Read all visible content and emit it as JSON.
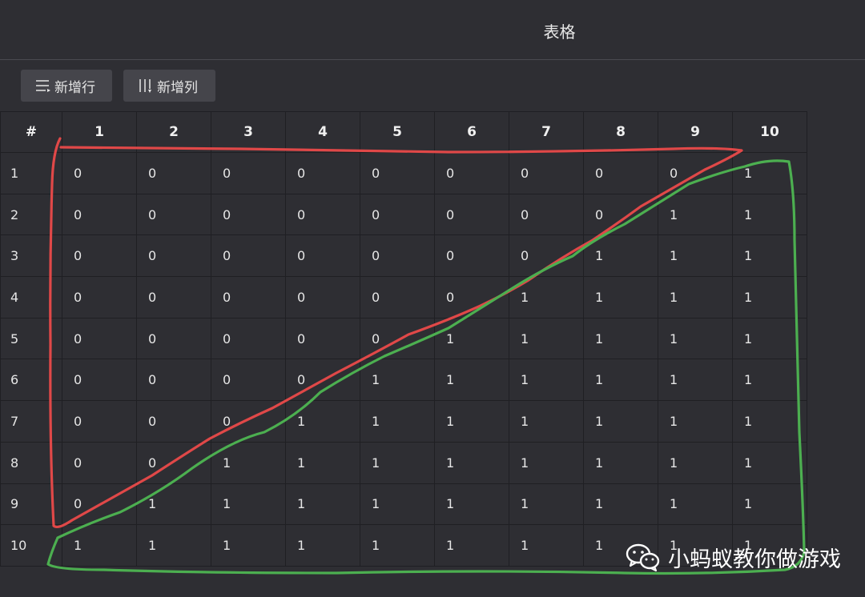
{
  "window": {
    "title": "表格"
  },
  "toolbar": {
    "add_row_label": "新增行",
    "add_col_label": "新增列"
  },
  "table": {
    "corner": "#",
    "columns": [
      "1",
      "2",
      "3",
      "4",
      "5",
      "6",
      "7",
      "8",
      "9",
      "10"
    ],
    "rows": [
      {
        "label": "1",
        "cells": [
          "0",
          "0",
          "0",
          "0",
          "0",
          "0",
          "0",
          "0",
          "0",
          "1"
        ]
      },
      {
        "label": "2",
        "cells": [
          "0",
          "0",
          "0",
          "0",
          "0",
          "0",
          "0",
          "0",
          "1",
          "1"
        ]
      },
      {
        "label": "3",
        "cells": [
          "0",
          "0",
          "0",
          "0",
          "0",
          "0",
          "0",
          "1",
          "1",
          "1"
        ]
      },
      {
        "label": "4",
        "cells": [
          "0",
          "0",
          "0",
          "0",
          "0",
          "0",
          "1",
          "1",
          "1",
          "1"
        ]
      },
      {
        "label": "5",
        "cells": [
          "0",
          "0",
          "0",
          "0",
          "0",
          "1",
          "1",
          "1",
          "1",
          "1"
        ]
      },
      {
        "label": "6",
        "cells": [
          "0",
          "0",
          "0",
          "0",
          "1",
          "1",
          "1",
          "1",
          "1",
          "1"
        ]
      },
      {
        "label": "7",
        "cells": [
          "0",
          "0",
          "0",
          "1",
          "1",
          "1",
          "1",
          "1",
          "1",
          "1"
        ]
      },
      {
        "label": "8",
        "cells": [
          "0",
          "0",
          "1",
          "1",
          "1",
          "1",
          "1",
          "1",
          "1",
          "1"
        ]
      },
      {
        "label": "9",
        "cells": [
          "0",
          "1",
          "1",
          "1",
          "1",
          "1",
          "1",
          "1",
          "1",
          "1"
        ]
      },
      {
        "label": "10",
        "cells": [
          "1",
          "1",
          "1",
          "1",
          "1",
          "1",
          "1",
          "1",
          "1",
          "1"
        ]
      }
    ]
  },
  "annotations": {
    "upper_outline_color": "#e04848",
    "lower_outline_color": "#4caf50"
  },
  "watermark": {
    "text": "小蚂蚁教你做游戏",
    "icon": "wechat-icon"
  },
  "colors": {
    "background": "#2e2e33",
    "button": "#45454b",
    "grid_line": "#1f1f23"
  }
}
